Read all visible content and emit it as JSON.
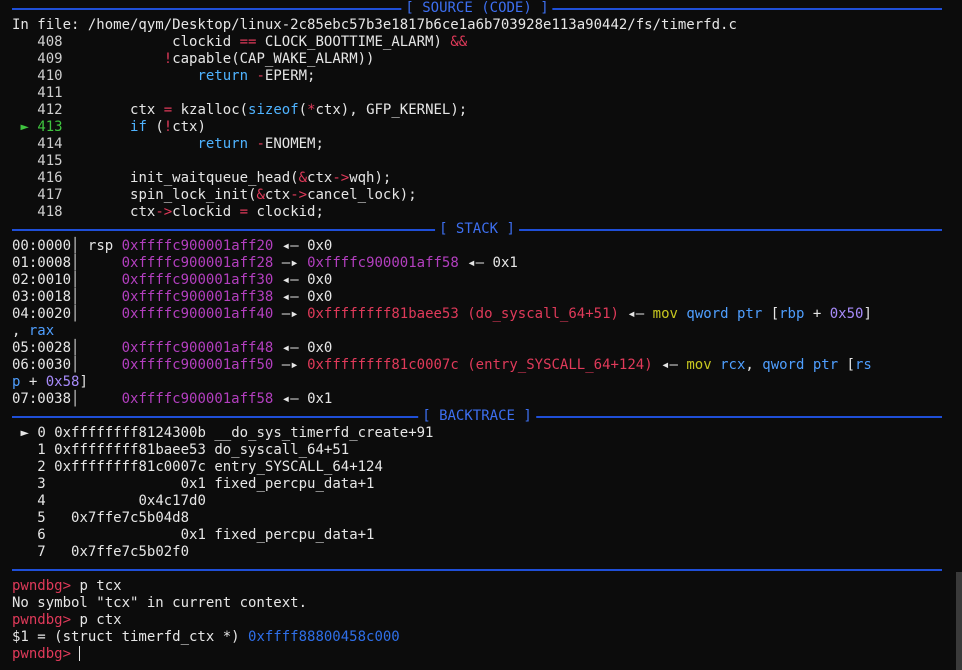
{
  "headers": {
    "source": "[ SOURCE (CODE) ]",
    "stack": "[ STACK ]",
    "backtrace": "[ BACKTRACE ]"
  },
  "source": {
    "file_line": "In file: /home/qym/Desktop/linux-2c85ebc57b3e1817b6ce1a6b703928e113a90442/fs/timerfd.c",
    "current_marker": "►",
    "lines": [
      {
        "num": "408",
        "code": "             clockid == CLOCK_BOOTTIME_ALARM) &&"
      },
      {
        "num": "409",
        "code": "            !capable(CAP_WAKE_ALARM))"
      },
      {
        "num": "410",
        "code": "                return -EPERM;"
      },
      {
        "num": "411",
        "code": ""
      },
      {
        "num": "412",
        "code": "        ctx = kzalloc(sizeof(*ctx), GFP_KERNEL);"
      },
      {
        "num": "413",
        "code": "        if (!ctx)"
      },
      {
        "num": "414",
        "code": "                return -ENOMEM;"
      },
      {
        "num": "415",
        "code": ""
      },
      {
        "num": "416",
        "code": "        init_waitqueue_head(&ctx->wqh);"
      },
      {
        "num": "417",
        "code": "        spin_lock_init(&ctx->cancel_lock);"
      },
      {
        "num": "418",
        "code": "        ctx->clockid = clockid;"
      }
    ]
  },
  "stack": [
    {
      "off": "00:0000",
      "reg": "rsp",
      "addr": "0xffffc900001aff20",
      "arrow": "◂—",
      "val": "0x0"
    },
    {
      "off": "01:0008",
      "reg": "",
      "addr": "0xffffc900001aff28",
      "arrow": "—▸",
      "ptr": "0xffffc900001aff58",
      "arrow2": "◂—",
      "val": "0x1"
    },
    {
      "off": "02:0010",
      "reg": "",
      "addr": "0xffffc900001aff30",
      "arrow": "◂—",
      "val": "0x0"
    },
    {
      "off": "03:0018",
      "reg": "",
      "addr": "0xffffc900001aff38",
      "arrow": "◂—",
      "val": "0x0"
    },
    {
      "off": "04:0020",
      "reg": "",
      "addr": "0xffffc900001aff40",
      "arrow": "—▸",
      "sym": "0xffffffff81baee53 (do_syscall_64+51)",
      "arrow2": "◂—",
      "insn": "mov",
      "a1": "qword ptr [rbp + 0x50]",
      "cont": ", rax"
    },
    {
      "off": "05:0028",
      "reg": "",
      "addr": "0xffffc900001aff48",
      "arrow": "◂—",
      "val": "0x0"
    },
    {
      "off": "06:0030",
      "reg": "",
      "addr": "0xffffc900001aff50",
      "arrow": "—▸",
      "sym": "0xffffffff81c0007c (entry_SYSCALL_64+124)",
      "arrow2": "◂—",
      "insn": "mov",
      "a1": "rcx, qword ptr [rs",
      "cont": "p + 0x58]"
    },
    {
      "off": "07:0038",
      "reg": "",
      "addr": "0xffffc900001aff58",
      "arrow": "◂—",
      "val": "0x1"
    }
  ],
  "backtrace": [
    {
      "marker": "►",
      "idx": "0",
      "addr": "0xffffffff8124300b",
      "sym": "__do_sys_timerfd_create+91"
    },
    {
      "marker": "",
      "idx": "1",
      "addr": "0xffffffff81baee53",
      "sym": "do_syscall_64+51"
    },
    {
      "marker": "",
      "idx": "2",
      "addr": "0xffffffff81c0007c",
      "sym": "entry_SYSCALL_64+124"
    },
    {
      "marker": "",
      "idx": "3",
      "addr": "               0x1",
      "sym": "fixed_percpu_data+1"
    },
    {
      "marker": "",
      "idx": "4",
      "addr": "          0x4c17d0",
      "sym": ""
    },
    {
      "marker": "",
      "idx": "5",
      "addr": "  0x7ffe7c5b04d8",
      "sym": ""
    },
    {
      "marker": "",
      "idx": "6",
      "addr": "               0x1",
      "sym": "fixed_percpu_data+1"
    },
    {
      "marker": "",
      "idx": "7",
      "addr": "  0x7ffe7c5b02f0",
      "sym": ""
    }
  ],
  "console": {
    "prompt": "pwndbg>",
    "cmd1": "p tcx",
    "out1": "No symbol \"tcx\" in current context.",
    "cmd2": "p ctx",
    "out2_prefix": "$1 = (struct timerfd_ctx *)",
    "out2_value": "0xffff88800458c000",
    "cmd3": ""
  },
  "colors": {
    "background": "#0c0c0c",
    "separator": "#1f4fd8",
    "prompt": "#e03a5a",
    "current_line": "#3fc43f"
  }
}
